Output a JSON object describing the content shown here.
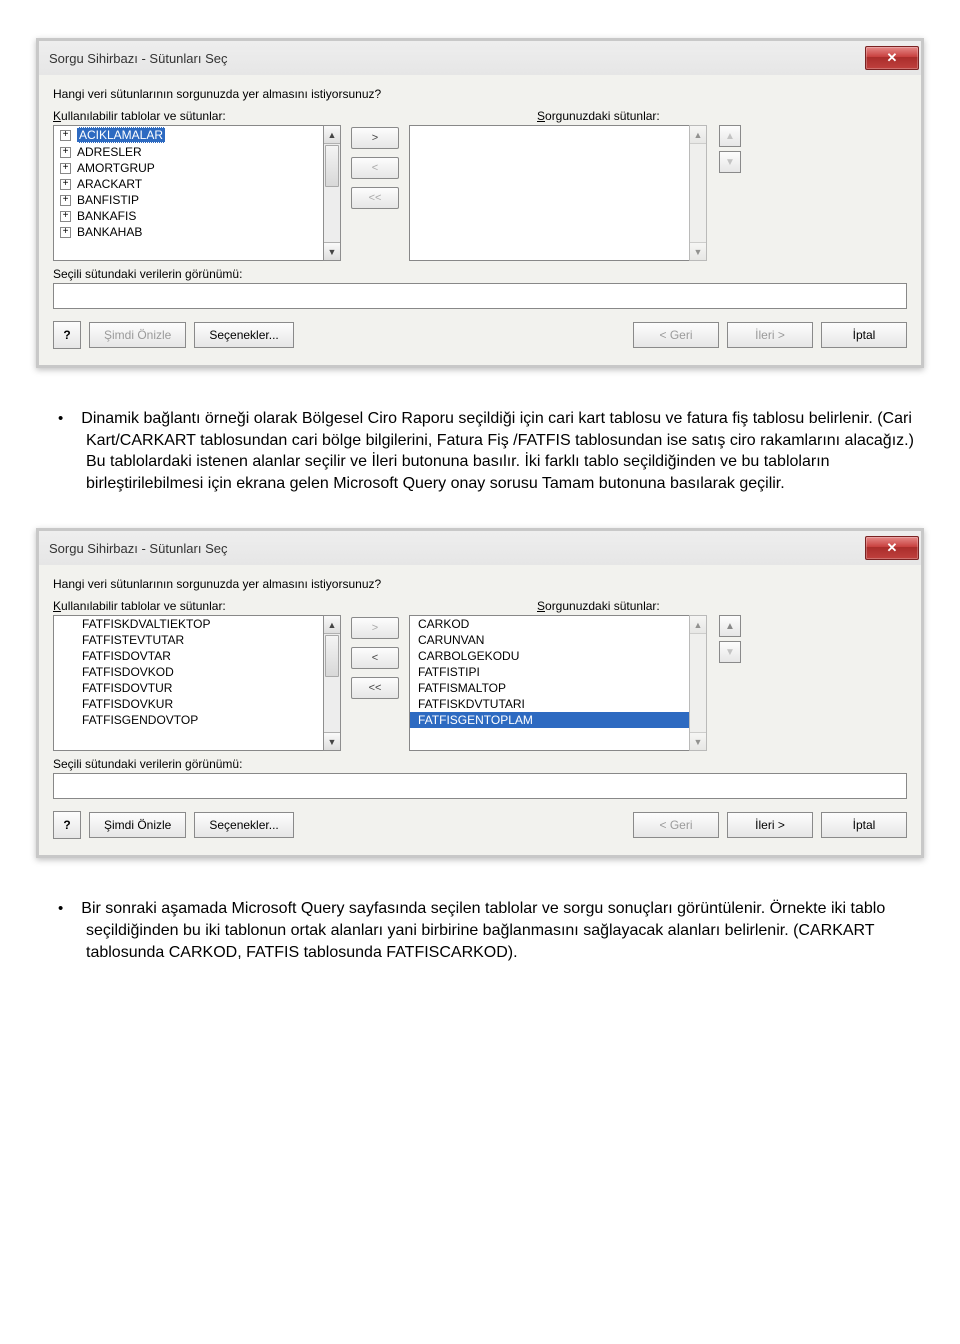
{
  "dialog1": {
    "title": "Sorgu Sihirbazı - Sütunları Seç",
    "prompt": "Hangi veri sütunlarının sorgunuzda yer almasını istiyorsunuz?",
    "left_label": "Kullanılabilir tablolar ve sütunlar:",
    "right_label": "Sorgunuzdaki sütunlar:",
    "left_items": [
      "ACIKLAMALAR",
      "ADRESLER",
      "AMORTGRUP",
      "ARACKART",
      "BANFISTIP",
      "BANKAFIS",
      "BANKAHAB"
    ],
    "left_selected_index": 0,
    "right_items": [],
    "preview_label": "Seçili sütundaki verilerin görünümü:",
    "btn_add": ">",
    "btn_remove": "<",
    "btn_remove_all": "<<",
    "btns": {
      "preview_now": "Şimdi Önizle",
      "options": "Seçenekler...",
      "back": "< Geri",
      "next": "İleri >",
      "cancel": "İptal"
    }
  },
  "paragraph1": "Dinamik bağlantı örneği olarak Bölgesel Ciro Raporu seçildiği için cari kart tablosu ve fatura fiş tablosu belirlenir. (Cari Kart/CARKART tablosundan cari bölge bilgilerini, Fatura Fiş /FATFIS tablosundan ise satış ciro rakamlarını alacağız.) Bu tablolardaki istenen alanlar seçilir ve İleri butonuna basılır. İki farklı tablo seçildiğinden ve bu tabloların birleştirilebilmesi için ekrana gelen Microsoft Query onay sorusu Tamam butonuna basılarak geçilir.",
  "dialog2": {
    "title": "Sorgu Sihirbazı - Sütunları Seç",
    "prompt": "Hangi veri sütunlarının sorgunuzda yer almasını istiyorsunuz?",
    "left_label": "Kullanılabilir tablolar ve sütunlar:",
    "right_label": "Sorgunuzdaki sütunlar:",
    "left_items": [
      "FATFISKDVALTIEKTOP",
      "FATFISTEVTUTAR",
      "FATFISDOVTAR",
      "FATFISDOVKOD",
      "FATFISDOVTUR",
      "FATFISDOVKUR",
      "FATFISGENDOVTOP"
    ],
    "right_items": [
      "CARKOD",
      "CARUNVAN",
      "CARBOLGEKODU",
      "FATFISTIPI",
      "FATFISMALTOP",
      "FATFISKDVTUTARI",
      "FATFISGENTOPLAM"
    ],
    "right_selected_index": 6,
    "preview_label": "Seçili sütundaki verilerin görünümü:",
    "btn_add": ">",
    "btn_remove": "<",
    "btn_remove_all": "<<",
    "btns": {
      "preview_now": "Şimdi Önizle",
      "options": "Seçenekler...",
      "back": "< Geri",
      "next": "İleri >",
      "cancel": "İptal"
    }
  },
  "paragraph2": "Bir sonraki aşamada Microsoft Query sayfasında seçilen tablolar ve sorgu sonuçları görüntülenir. Örnekte iki tablo seçildiğinden bu iki tablonun ortak alanları yani birbirine bağlanmasını sağlayacak alanları belirlenir. (CARKART tablosunda CARKOD, FATFIS tablosunda FATFISCARKOD)."
}
